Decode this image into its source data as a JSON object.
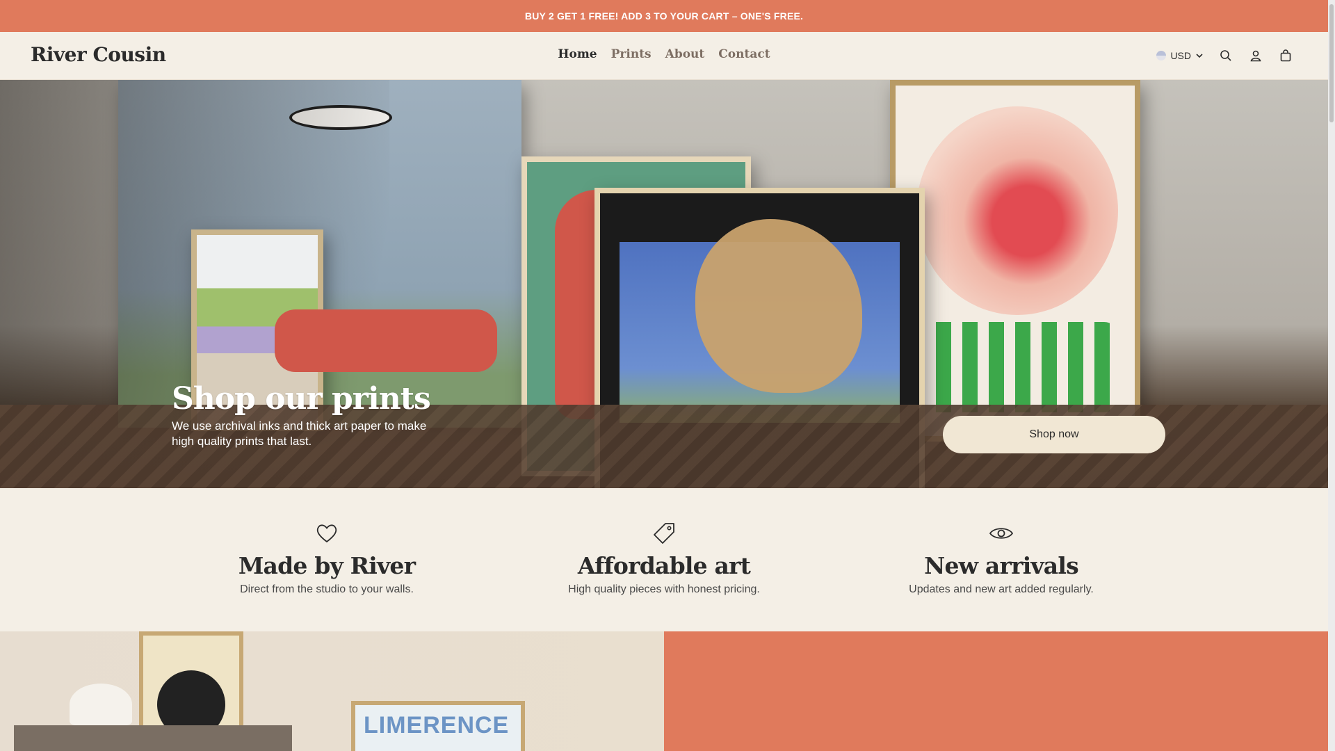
{
  "announcement": {
    "text": "BUY 2 GET 1 FREE! ADD 3 TO YOUR CART – ONE'S FREE."
  },
  "header": {
    "logo": "River Cousin",
    "nav": [
      {
        "label": "Home",
        "active": true
      },
      {
        "label": "Prints",
        "active": false
      },
      {
        "label": "About",
        "active": false
      },
      {
        "label": "Contact",
        "active": false
      }
    ],
    "currency": "USD",
    "icons": [
      "flag-icon",
      "chevron-down-icon",
      "search-icon",
      "account-icon",
      "cart-icon"
    ]
  },
  "hero": {
    "title": "Shop our prints",
    "subtitle": "We use archival inks and thick art paper to make high quality prints that last.",
    "button_label": "Shop now"
  },
  "features": [
    {
      "icon": "heart-icon",
      "title": "Made by River",
      "text": "Direct from the studio to your walls."
    },
    {
      "icon": "tag-icon",
      "title": "Affordable art",
      "text": "High quality pieces with honest pricing."
    },
    {
      "icon": "eye-icon",
      "title": "New arrivals",
      "text": "Updates and new art added regularly."
    }
  ],
  "colors": {
    "accent": "#e07a5c",
    "background": "#f4efe6",
    "button": "#f1e7d4",
    "text": "#2b2b2b"
  }
}
